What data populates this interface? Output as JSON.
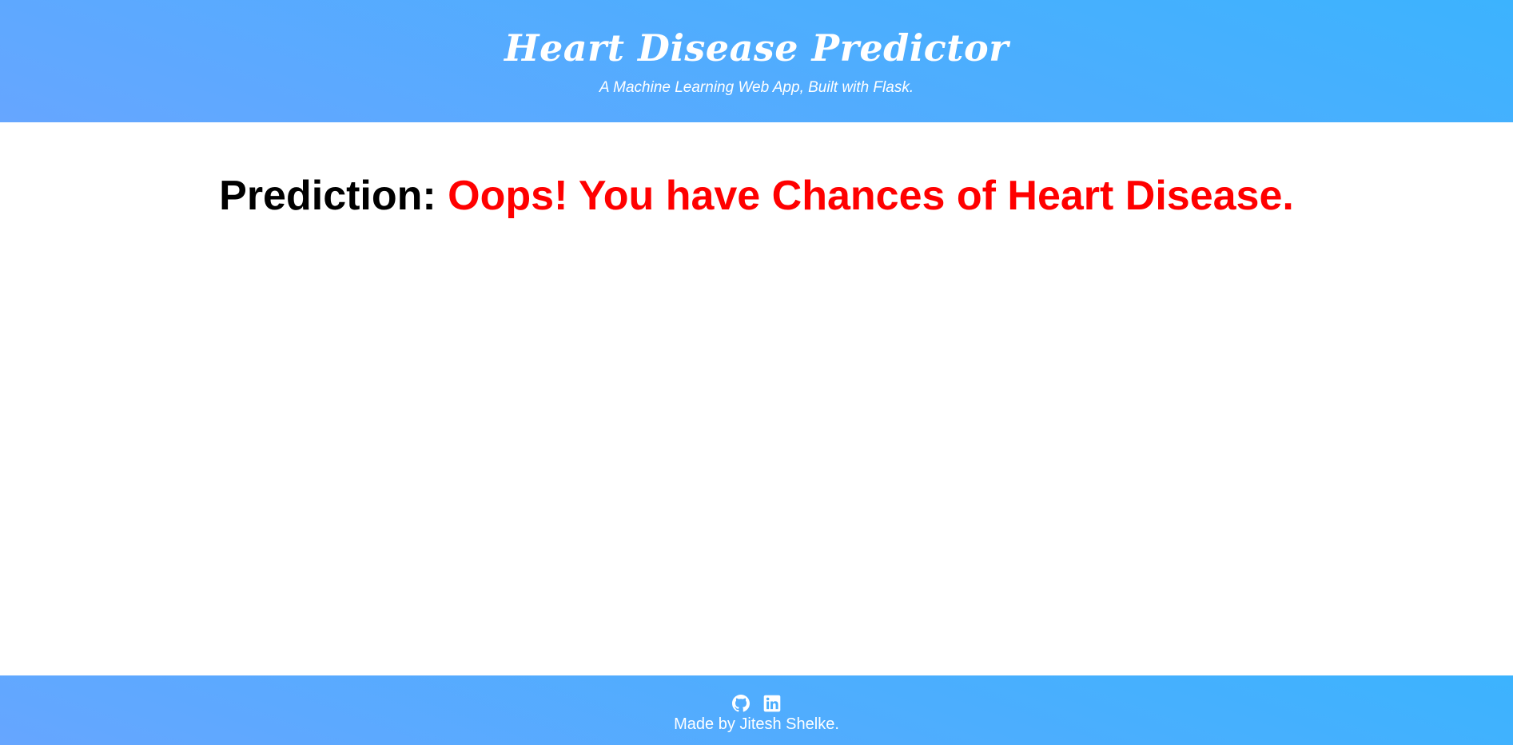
{
  "header": {
    "title": "Heart Disease Predictor",
    "subtitle": "A Machine Learning Web App, Built with Flask."
  },
  "main": {
    "prediction_label": "Prediction:",
    "prediction_result": "Oops! You have Chances of Heart Disease."
  },
  "footer": {
    "icons": [
      "github-icon",
      "linkedin-icon"
    ],
    "credit": "Made by Jitesh Shelke."
  },
  "colors": {
    "header_gradient_start": "#66a6ff",
    "header_gradient_end": "#3cb3fe",
    "result_text": "#ff0000",
    "label_text": "#000000"
  }
}
